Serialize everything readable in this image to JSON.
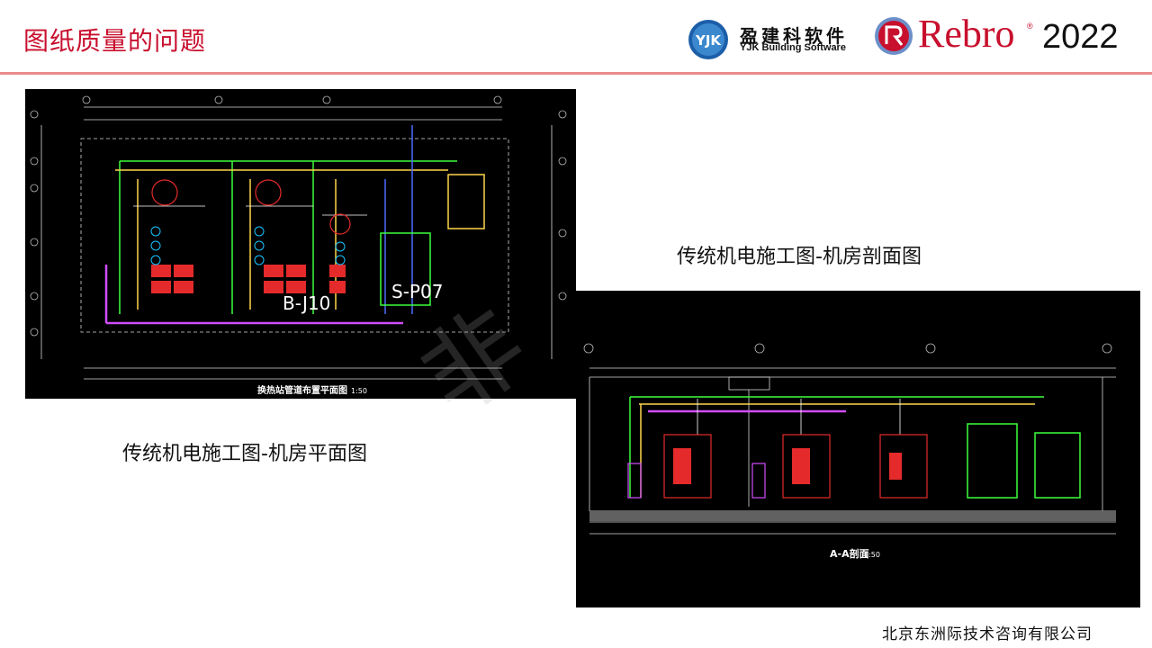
{
  "slide": {
    "title": "图纸质量的问题",
    "footer_company": "北京东洲际技术咨询有限公司",
    "watermark_text": "非",
    "accent_color": "#c8102e",
    "rule_color": "#e98a8a"
  },
  "logos": {
    "yjk_badge": "YJK",
    "yjk_name_cn": "盈建科软件",
    "yjk_name_en": "YJK Building Software",
    "rebro_name": "Rebro",
    "rebro_reg": "®",
    "rebro_year": "2022"
  },
  "plan_drawing": {
    "caption": "传统机电施工图-机房平面图",
    "tag_left": "B-J10",
    "tag_right": "S-P07",
    "sheet_title": "换热站管道布置平面图",
    "scale": "1:50"
  },
  "section_drawing": {
    "caption": "传统机电施工图-机房剖面图",
    "sheet_title": "A-A剖面",
    "scale": "1:50"
  }
}
